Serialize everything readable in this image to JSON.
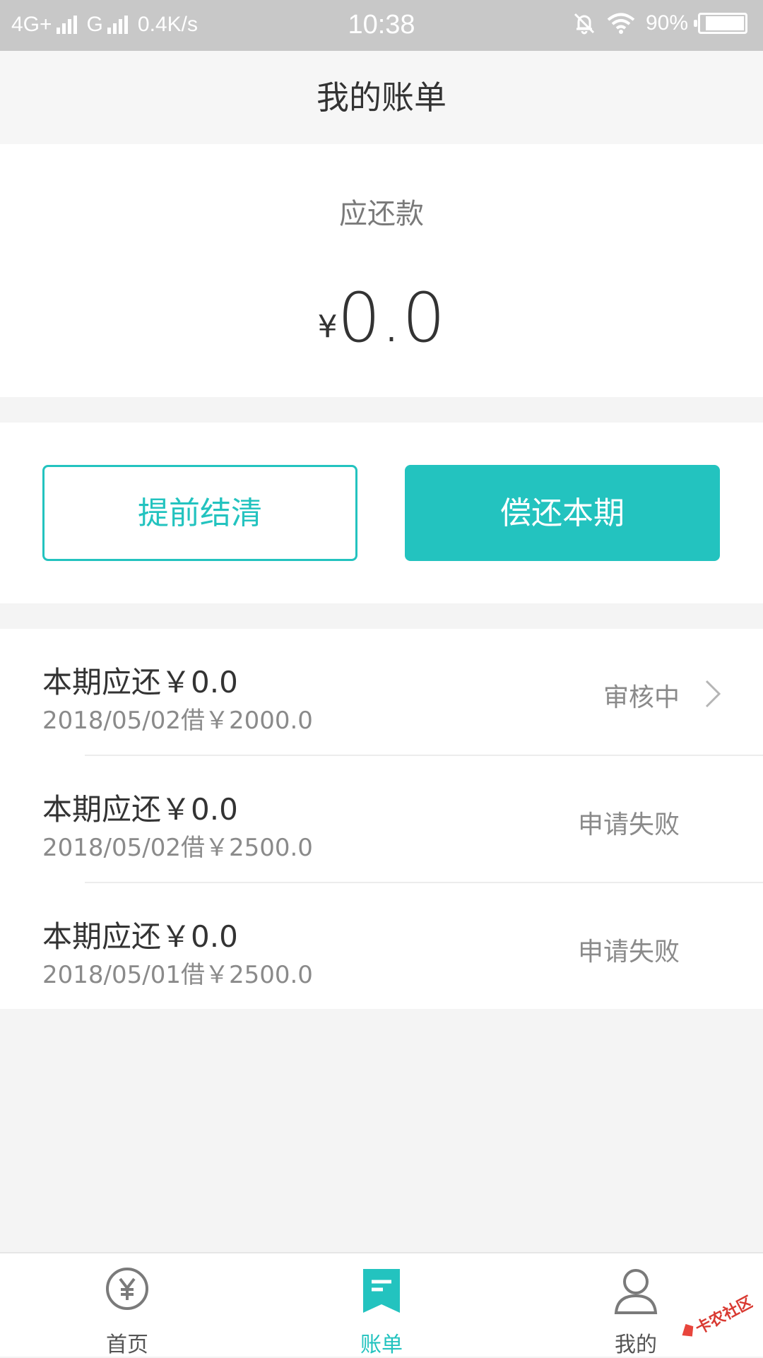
{
  "status_bar": {
    "network1": "4G+",
    "network2": "G",
    "speed": "0.4K/s",
    "time": "10:38",
    "battery": "90%",
    "battery_level": 0.9
  },
  "header": {
    "title": "我的账单"
  },
  "summary": {
    "label": "应还款",
    "currency": "¥",
    "amount": "0.0"
  },
  "actions": {
    "early_payoff": "提前结清",
    "repay_current": "偿还本期"
  },
  "bills": [
    {
      "title": "本期应还￥0.0",
      "subtitle": "2018/05/02借￥2000.0",
      "status": "审核中",
      "has_chevron": true
    },
    {
      "title": "本期应还￥0.0",
      "subtitle": "2018/05/02借￥2500.0",
      "status": "申请失败",
      "has_chevron": false
    },
    {
      "title": "本期应还￥0.0",
      "subtitle": "2018/05/01借￥2500.0",
      "status": "申请失败",
      "has_chevron": false
    }
  ],
  "tabs": [
    {
      "label": "首页",
      "icon": "yuan-circle-icon",
      "active": false
    },
    {
      "label": "账单",
      "icon": "bill-icon",
      "active": true
    },
    {
      "label": "我的",
      "icon": "user-icon",
      "active": false
    }
  ],
  "watermark": {
    "text": "卡农社区"
  },
  "colors": {
    "accent": "#23c3bf",
    "status_bar": "#c8c8c8"
  }
}
